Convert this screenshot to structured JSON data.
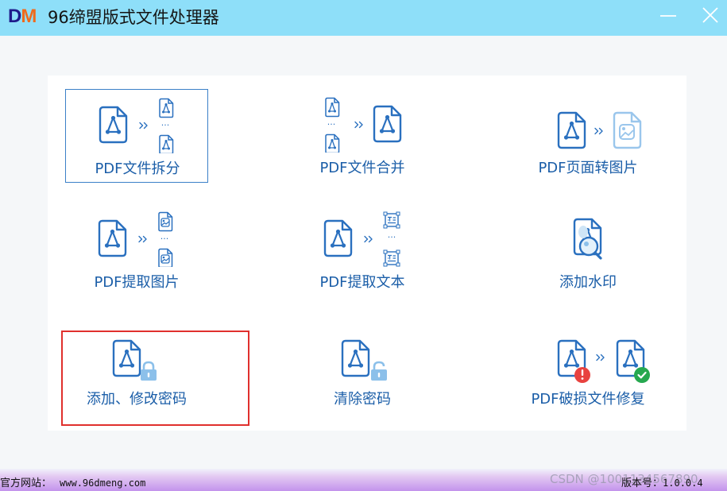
{
  "app": {
    "logo_d": "D",
    "logo_m": "M",
    "title": "96缔盟版式文件处理器"
  },
  "tools": [
    {
      "label": "PDF文件拆分"
    },
    {
      "label": "PDF文件合并"
    },
    {
      "label": "PDF页面转图片"
    },
    {
      "label": "PDF提取图片"
    },
    {
      "label": "PDF提取文本"
    },
    {
      "label": "添加水印"
    },
    {
      "label": "添加、修改密码"
    },
    {
      "label": "清除密码"
    },
    {
      "label": "PDF破损文件修复"
    }
  ],
  "footer": {
    "website_label": "官方网站：",
    "website_url": "www.96dmeng.com",
    "watermark": "CSDN @1001134567890",
    "version_label": "版本号：",
    "version_value": "1.0.0.4"
  },
  "colors": {
    "titlebar": "#8edff9",
    "accent_blue": "#1b5ea8",
    "icon_blue": "#2a70bf",
    "highlight_red": "#e0302d",
    "alert_red": "#e8423f",
    "ok_green": "#26a84f"
  }
}
